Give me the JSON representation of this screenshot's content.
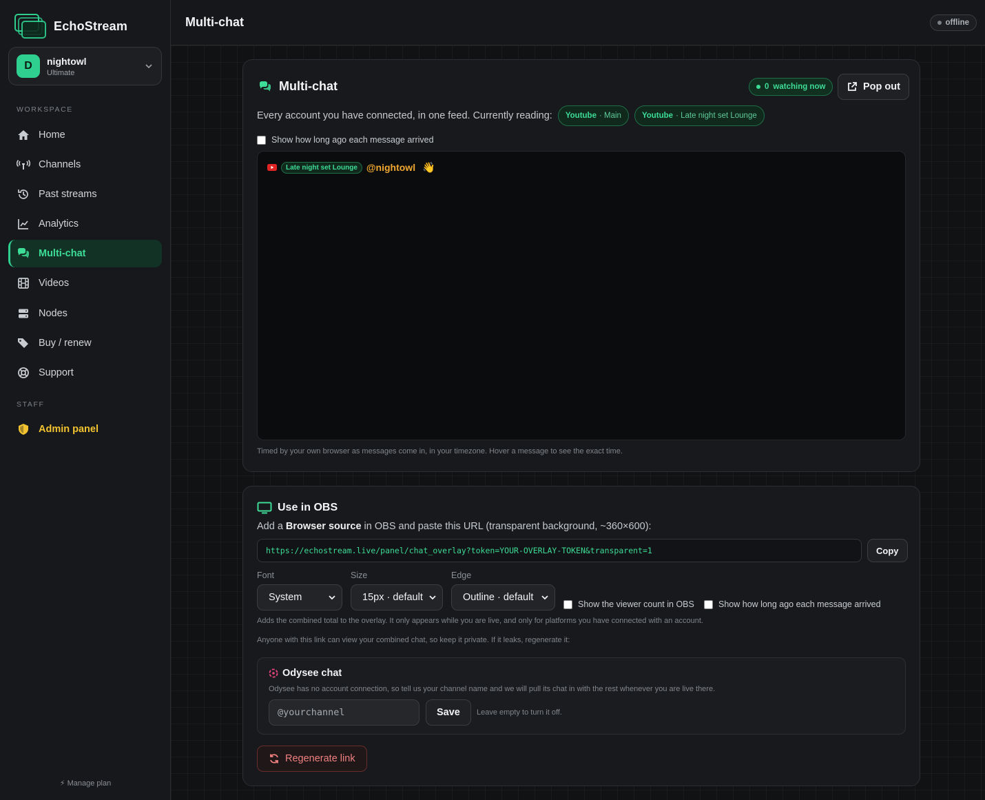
{
  "app": {
    "name": "EchoStream"
  },
  "account": {
    "initial": "D",
    "name": "nightowl",
    "plan": "Ultimate"
  },
  "sidebar": {
    "workspace_label": "WORKSPACE",
    "staff_label": "STAFF",
    "items": [
      {
        "label": "Home",
        "icon": "home-icon"
      },
      {
        "label": "Channels",
        "icon": "antenna-icon"
      },
      {
        "label": "Past streams",
        "icon": "history-icon"
      },
      {
        "label": "Analytics",
        "icon": "chart-line-icon"
      },
      {
        "label": "Multi-chat",
        "icon": "chat-bubbles-icon",
        "active": true
      },
      {
        "label": "Videos",
        "icon": "film-icon"
      },
      {
        "label": "Nodes",
        "icon": "server-icon"
      },
      {
        "label": "Buy / renew",
        "icon": "tags-icon"
      },
      {
        "label": "Support",
        "icon": "lifebuoy-icon"
      }
    ],
    "admin": {
      "label": "Admin panel",
      "icon": "shield-icon"
    },
    "manage_plan": "Manage plan"
  },
  "header": {
    "title": "Multi-chat",
    "status": "offline"
  },
  "multichat": {
    "title": "Multi-chat",
    "watching_count": "0",
    "watching_label": "watching now",
    "popout_label": "Pop out",
    "reading_text": "Every account you have connected, in one feed. Currently reading:",
    "sources": [
      {
        "platform": "Youtube",
        "name": "· Main"
      },
      {
        "platform": "Youtube",
        "name": "· Late night set Lounge"
      }
    ],
    "show_time_label": "Show how long ago each message arrived",
    "messages": [
      {
        "platform_icon": "youtube-icon",
        "channel": "Late night set Lounge",
        "user": "@nightowl",
        "text": "👋"
      }
    ],
    "footnote": "Timed by your own browser as messages come in, in your timezone. Hover a message to see the exact time."
  },
  "obs": {
    "title": "Use in OBS",
    "desc_prefix": "Add a ",
    "desc_bold": "Browser source",
    "desc_suffix": " in OBS and paste this URL (transparent background, ~360×600):",
    "url": "https://echostream.live/panel/chat_overlay?token=YOUR-OVERLAY-TOKEN&transparent=1",
    "copy_label": "Copy",
    "font_label": "Font",
    "font_value": "System",
    "size_label": "Size",
    "size_value": "15px · default",
    "edge_label": "Edge",
    "edge_value": "Outline · default",
    "viewer_count_label": "Show the viewer count in OBS",
    "show_time_label": "Show how long ago each message arrived",
    "viewer_note": "Adds the combined total to the overlay. It only appears while you are live, and only for platforms you have connected with an account.",
    "private_note": "Anyone with this link can view your combined chat, so keep it private. If it leaks, regenerate it:",
    "odysee": {
      "title": "Odysee chat",
      "desc": "Odysee has no account connection, so tell us your channel name and we will pull its chat in with the rest whenever you are live there.",
      "placeholder": "@yourchannel",
      "save_label": "Save",
      "hint": "Leave empty to turn it off."
    },
    "regenerate_label": "Regenerate link"
  },
  "colors": {
    "accent": "#3ddc97",
    "admin": "#f2c230",
    "danger": "#f08080",
    "username": "#f0a830"
  }
}
